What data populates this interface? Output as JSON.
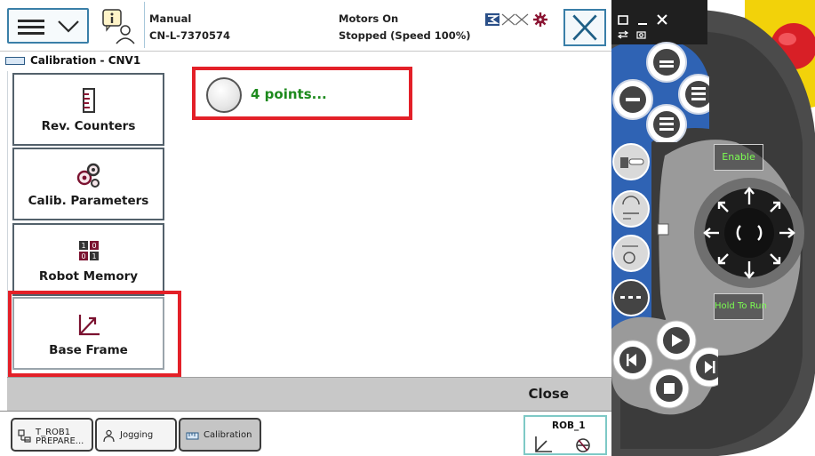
{
  "topbar": {
    "mode": "Manual",
    "controller": "CN-L-7370574",
    "motors": "Motors On",
    "state": "Stopped (Speed 100%)"
  },
  "window": {
    "title": "Calibration - CNV1"
  },
  "sidebar": {
    "items": [
      {
        "label": "Rev. Counters",
        "icon": "rev-counters-icon"
      },
      {
        "label": "Calib. Parameters",
        "icon": "calib-parameters-icon"
      },
      {
        "label": "Robot Memory",
        "icon": "robot-memory-icon"
      },
      {
        "label": "Base Frame",
        "icon": "base-frame-icon"
      }
    ]
  },
  "main": {
    "option_label": "4 points..."
  },
  "footer": {
    "close_label": "Close"
  },
  "taskbar": {
    "tasks": [
      {
        "line1": "T_ROB1",
        "line2": "PREPARE...",
        "icon": "program-icon"
      },
      {
        "label": "Jogging",
        "icon": "jogging-icon"
      },
      {
        "label": "Calibration",
        "icon": "calibration-icon",
        "active": true
      }
    ],
    "robot_unit": "ROB_1"
  },
  "device": {
    "enable_label": "Enable",
    "hold_label": "Hold To Run"
  },
  "colors": {
    "highlight": "#e32028",
    "option_text": "#1d8a1d",
    "device_label": "#7cff52",
    "device_yellow": "#f2d20a",
    "emergency_red": "#d81f26"
  }
}
